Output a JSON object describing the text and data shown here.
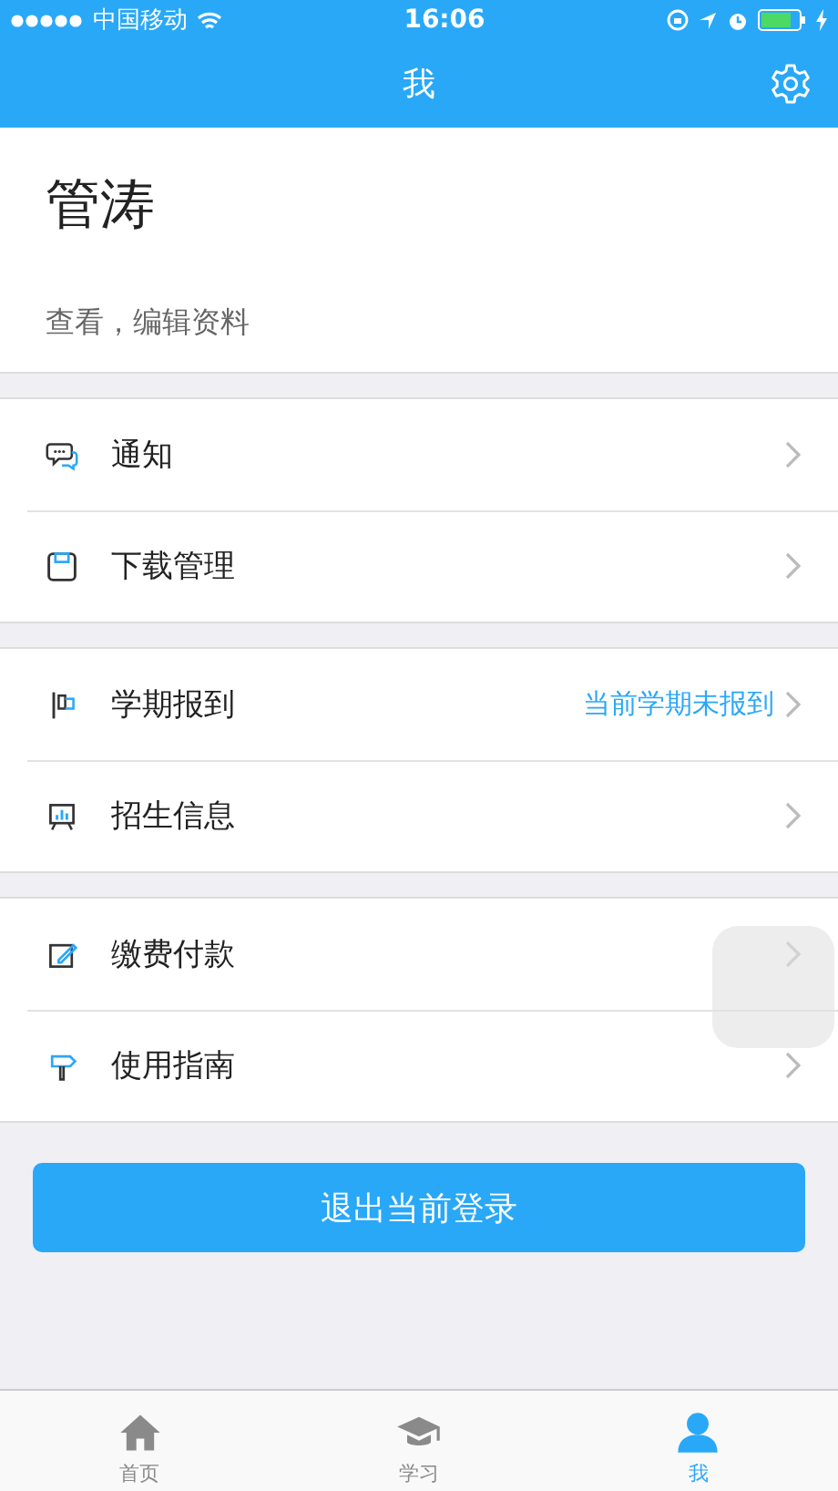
{
  "status_bar": {
    "carrier": "中国移动",
    "time": "16:06"
  },
  "nav_bar": {
    "title": "我"
  },
  "profile": {
    "name": "管涛",
    "subtitle": "查看，编辑资料"
  },
  "menu_groups": [
    {
      "items": [
        {
          "label": "通知"
        },
        {
          "label": "下载管理"
        }
      ]
    },
    {
      "items": [
        {
          "label": "学期报到",
          "detail": "当前学期未报到"
        },
        {
          "label": "招生信息"
        }
      ]
    },
    {
      "items": [
        {
          "label": "缴费付款"
        },
        {
          "label": "使用指南"
        }
      ]
    }
  ],
  "logout_button": "退出当前登录",
  "tab_bar": [
    {
      "label": "首页",
      "selected": false
    },
    {
      "label": "学习",
      "selected": false
    },
    {
      "label": "我",
      "selected": true
    }
  ]
}
